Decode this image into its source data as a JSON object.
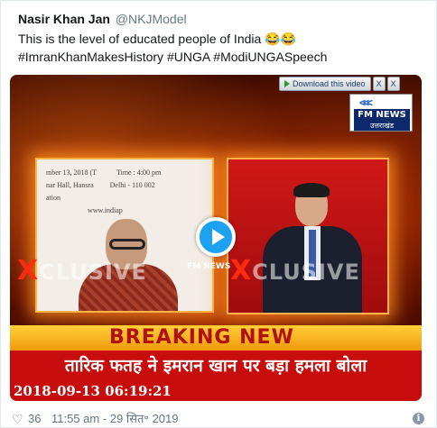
{
  "tweet": {
    "author_name": "Nasir Khan Jan",
    "author_handle": "@NKJModel",
    "text_line1": "This is the level of educated people of India ",
    "emoji": "😂😂",
    "text_line2": "#ImranKhanMakesHistory #UNGA #ModiUNGASpeech"
  },
  "video": {
    "download_label": "Download this video",
    "ctrl_x1": "X",
    "ctrl_x2": "X",
    "channel_brand": "FM NEWS",
    "channel_region": "उत्तराखंड",
    "watermark": "FM NEWS",
    "exclusive_left": "CLUSIVE",
    "exclusive_right": "CLUSIVE",
    "exclusive_x": "X",
    "doc_line1": "mber 13, 2018 (T",
    "doc_line2": "nar Hall, Hansra",
    "doc_line3": "ation",
    "doc_time": "Time : 4:00 pm",
    "doc_place": "Delhi - 110 002",
    "doc_url": "www.indiap",
    "breaking_text": "BREAKING NEW",
    "headline": "तारिक फतह ने इमरान खान पर बड़ा हमला बोला",
    "timestamp": "2018-09-13 06:19:21"
  },
  "footer": {
    "likes": "36",
    "time": "11:55 am - 29 सित॰ 2019",
    "info_symbol": "i"
  },
  "colors": {
    "breaking_bg": "#f29a0a",
    "breaking_text": "#b01010",
    "strip_red": "#c80d0d",
    "play_blue": "#1da1f2"
  }
}
